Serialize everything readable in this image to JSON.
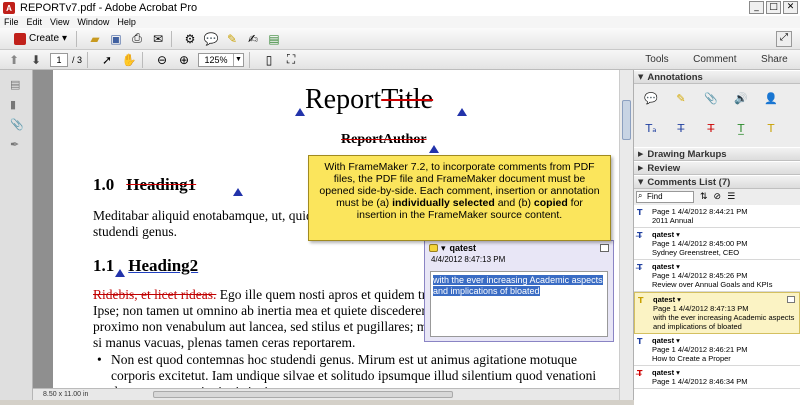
{
  "window": {
    "title": "REPORTv7.pdf - Adobe Acrobat Pro",
    "min": "_",
    "max": "□",
    "close": "✕"
  },
  "menu": [
    "File",
    "Edit",
    "View",
    "Window",
    "Help"
  ],
  "toolbar": {
    "create_label": "Create",
    "page_current": "1",
    "page_total": "/ 3",
    "zoom": "125%"
  },
  "right_tabs": [
    "Tools",
    "Comment",
    "Share"
  ],
  "document": {
    "title_plain": "Report",
    "title_struck": "Title",
    "author_struck": "ReportAuthor",
    "h1_number": "1.0",
    "h1_struck": "Heading1",
    "para1": "Meditabar aliquid enotabamque, ut, quid in isto loco commodus esset quod contemnas hoc studendi genus.",
    "h2_number": "1.1",
    "h2_text": "Heading2",
    "para2_struck": "Ridebis, et licet rideas.",
    "para2": " Ego ille quem nosti apros et quidem tres, et quidem pulcherrimos, cepi. Ipse; non tamen ut omnino ab inertia mea et quiete discederem. Ad retia sedebam; erat in proximo non venabulum aut lancea, sed stilus et pugillares; meditabar aliquid enotabamque, ut, si manus vacuas, plenas tamen ceras reportarem.",
    "bullet1": "Non est quod contemnas hoc studendi genus. Mirum est ut animus agitatione motuque corporis excitetut. Iam undique silvae et solitudo ipsumque illud silentium quod venationi datur magna cogitationis incitamenta sunt.",
    "page_size": "8.50 x 11.00 in"
  },
  "tooltip": {
    "line1": "With FrameMaker 7.2, to incorporate comments from PDF files, the PDF file and FrameMaker document must be opened side-by-side. Each comment, insertion or annotation must be (a) ",
    "bold1": "individually selected",
    "line2": " and (b) ",
    "bold2": "copied",
    "line3": " for insertion in the FrameMaker source content."
  },
  "popup": {
    "author": "qatest",
    "date": "4/4/2012 8:47:13 PM",
    "text": "with the ever increasing Academic aspects and implications of bloated"
  },
  "panel": {
    "annotations": "Annotations",
    "drawing": "Drawing Markups",
    "review": "Review",
    "comments_list": "Comments List (7)",
    "find": "Find"
  },
  "comments": [
    {
      "author": "",
      "line1": "Page 1  4/4/2012 8:44:21 PM",
      "line2": "2011 Annual",
      "icon": "insert-icon"
    },
    {
      "author": "qatest",
      "line1": "Page 1  4/4/2012 8:45:00 PM",
      "line2": "Sydney Greenstreet, CEO",
      "icon": "replace-icon"
    },
    {
      "author": "qatest",
      "line1": "Page 1  4/4/2012 8:45:26 PM",
      "line2": "Review over Annual Goals and KPIs",
      "icon": "replace-icon"
    },
    {
      "author": "qatest",
      "line1": "Page 1  4/4/2012 8:47:13 PM",
      "line2": "with the ever increasing Academic aspects and implications of bloated",
      "icon": "note-icon"
    },
    {
      "author": "qatest",
      "line1": "Page 1  4/4/2012 8:46:21 PM",
      "line2": "How to Create a Proper",
      "icon": "text-icon"
    },
    {
      "author": "qatest",
      "line1": "Page 1  4/4/2012 8:46:34 PM",
      "line2": "",
      "icon": "strike-icon"
    }
  ]
}
